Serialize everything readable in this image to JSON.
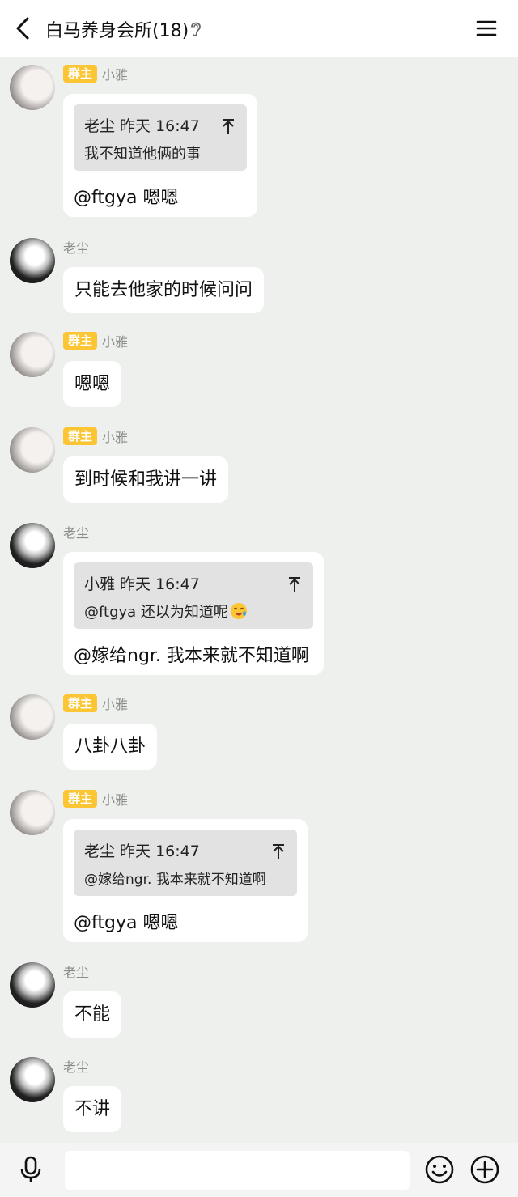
{
  "header": {
    "title": "白马养身会所(18)"
  },
  "messages": [
    {
      "sender": "小雅",
      "badge": "群主",
      "quote_author": "老尘 昨天 16:47",
      "quote_text": "我不知道他俩的事",
      "text": "@ftgya 嗯嗯"
    },
    {
      "sender": "老尘",
      "text": "只能去他家的时候问问"
    },
    {
      "sender": "小雅",
      "badge": "群主",
      "text": "嗯嗯"
    },
    {
      "sender": "小雅",
      "badge": "群主",
      "text": "到时候和我讲一讲"
    },
    {
      "sender": "老尘",
      "quote_author": "小雅 昨天 16:47",
      "quote_text": "@ftgya 还以为知道呢",
      "text": "@嫁给ngr. 我本来就不知道啊"
    },
    {
      "sender": "小雅",
      "badge": "群主",
      "text": "八卦八卦"
    },
    {
      "sender": "小雅",
      "badge": "群主",
      "quote_author": "老尘 昨天 16:47",
      "quote_text": "@嫁给ngr. 我本来就不知道啊",
      "text": "@ftgya 嗯嗯"
    },
    {
      "sender": "老尘",
      "text": "不能"
    },
    {
      "sender": "老尘",
      "text": "不讲"
    }
  ],
  "input": {
    "value": ""
  },
  "colors": {
    "background": "#edf0ed",
    "badge": "#fbc533",
    "bubble": "#ffffff",
    "quote": "#e2e2e2"
  },
  "icons": {
    "back": "chevron-left-icon",
    "ear": "ear-icon",
    "menu": "hamburger-menu-icon",
    "mic": "microphone-icon",
    "emoji": "smiley-icon",
    "plus": "plus-circle-icon",
    "quote_jump": "jump-to-top-icon"
  }
}
